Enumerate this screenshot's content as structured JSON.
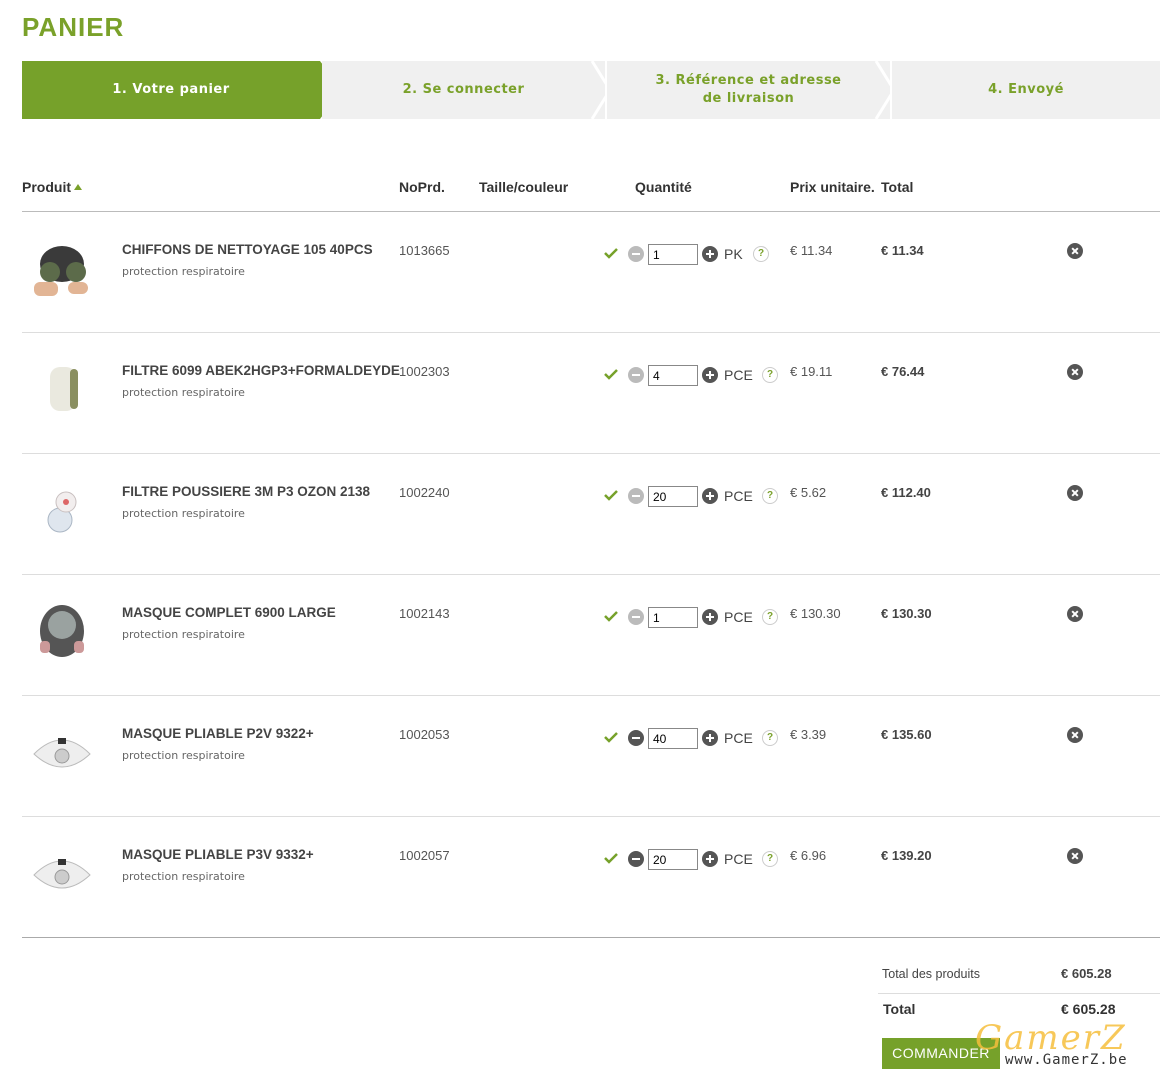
{
  "page": {
    "title": "PANIER"
  },
  "steps": [
    {
      "label": "1. Votre panier"
    },
    {
      "label": "2. Se connecter"
    },
    {
      "label": "3. Référence et adresse de livraison"
    },
    {
      "label": "4. Envoyé"
    }
  ],
  "table": {
    "headers": {
      "product": "Produit",
      "nop": "NoPrd.",
      "size": "Taille/couleur",
      "qty": "Quantité",
      "unit_price": "Prix unitaire.",
      "total": "Total"
    },
    "help_glyph": "?",
    "rows": [
      {
        "name": "CHIFFONS DE NETTOYAGE 105 40PCS",
        "category": "protection respiratoire",
        "nop": "1013665",
        "qty": "1",
        "unit": "PK",
        "unit_price": "€ 11.34",
        "total": "€ 11.34",
        "image": "mask-half-icon"
      },
      {
        "name": "FILTRE 6099 ABEK2HGP3+FORMALDEYDE",
        "category": "protection respiratoire",
        "nop": "1002303",
        "qty": "4",
        "unit": "PCE",
        "unit_price": "€ 19.11",
        "total": "€ 76.44",
        "image": "filter-cartridge-icon"
      },
      {
        "name": "FILTRE POUSSIERE 3M P3 OZON 2138",
        "category": "protection respiratoire",
        "nop": "1002240",
        "qty": "20",
        "unit": "PCE",
        "unit_price": "€ 5.62",
        "total": "€ 112.40",
        "image": "dust-filter-icon"
      },
      {
        "name": "MASQUE COMPLET 6900 LARGE",
        "category": "protection respiratoire",
        "nop": "1002143",
        "qty": "1",
        "unit": "PCE",
        "unit_price": "€ 130.30",
        "total": "€ 130.30",
        "image": "full-face-mask-icon"
      },
      {
        "name": "MASQUE PLIABLE P2V 9322+",
        "category": "protection respiratoire",
        "nop": "1002053",
        "qty": "40",
        "unit": "PCE",
        "unit_price": "€ 3.39",
        "total": "€ 135.60",
        "image": "foldable-mask-icon"
      },
      {
        "name": "MASQUE PLIABLE P3V 9332+",
        "category": "protection respiratoire",
        "nop": "1002057",
        "qty": "20",
        "unit": "PCE",
        "unit_price": "€ 6.96",
        "total": "€ 139.20",
        "image": "foldable-mask-icon"
      }
    ]
  },
  "summary": {
    "subtotal_label": "Total des produits",
    "subtotal_value": "€ 605.28",
    "total_label": "Total",
    "total_value": "€ 605.28",
    "order_button": "COMMANDER"
  },
  "watermark": {
    "big": "GamerZ",
    "small": "www.GamerZ.be"
  },
  "colors": {
    "accent": "#76a12a",
    "step_gray": "#f0f0f0",
    "text": "#333333"
  }
}
